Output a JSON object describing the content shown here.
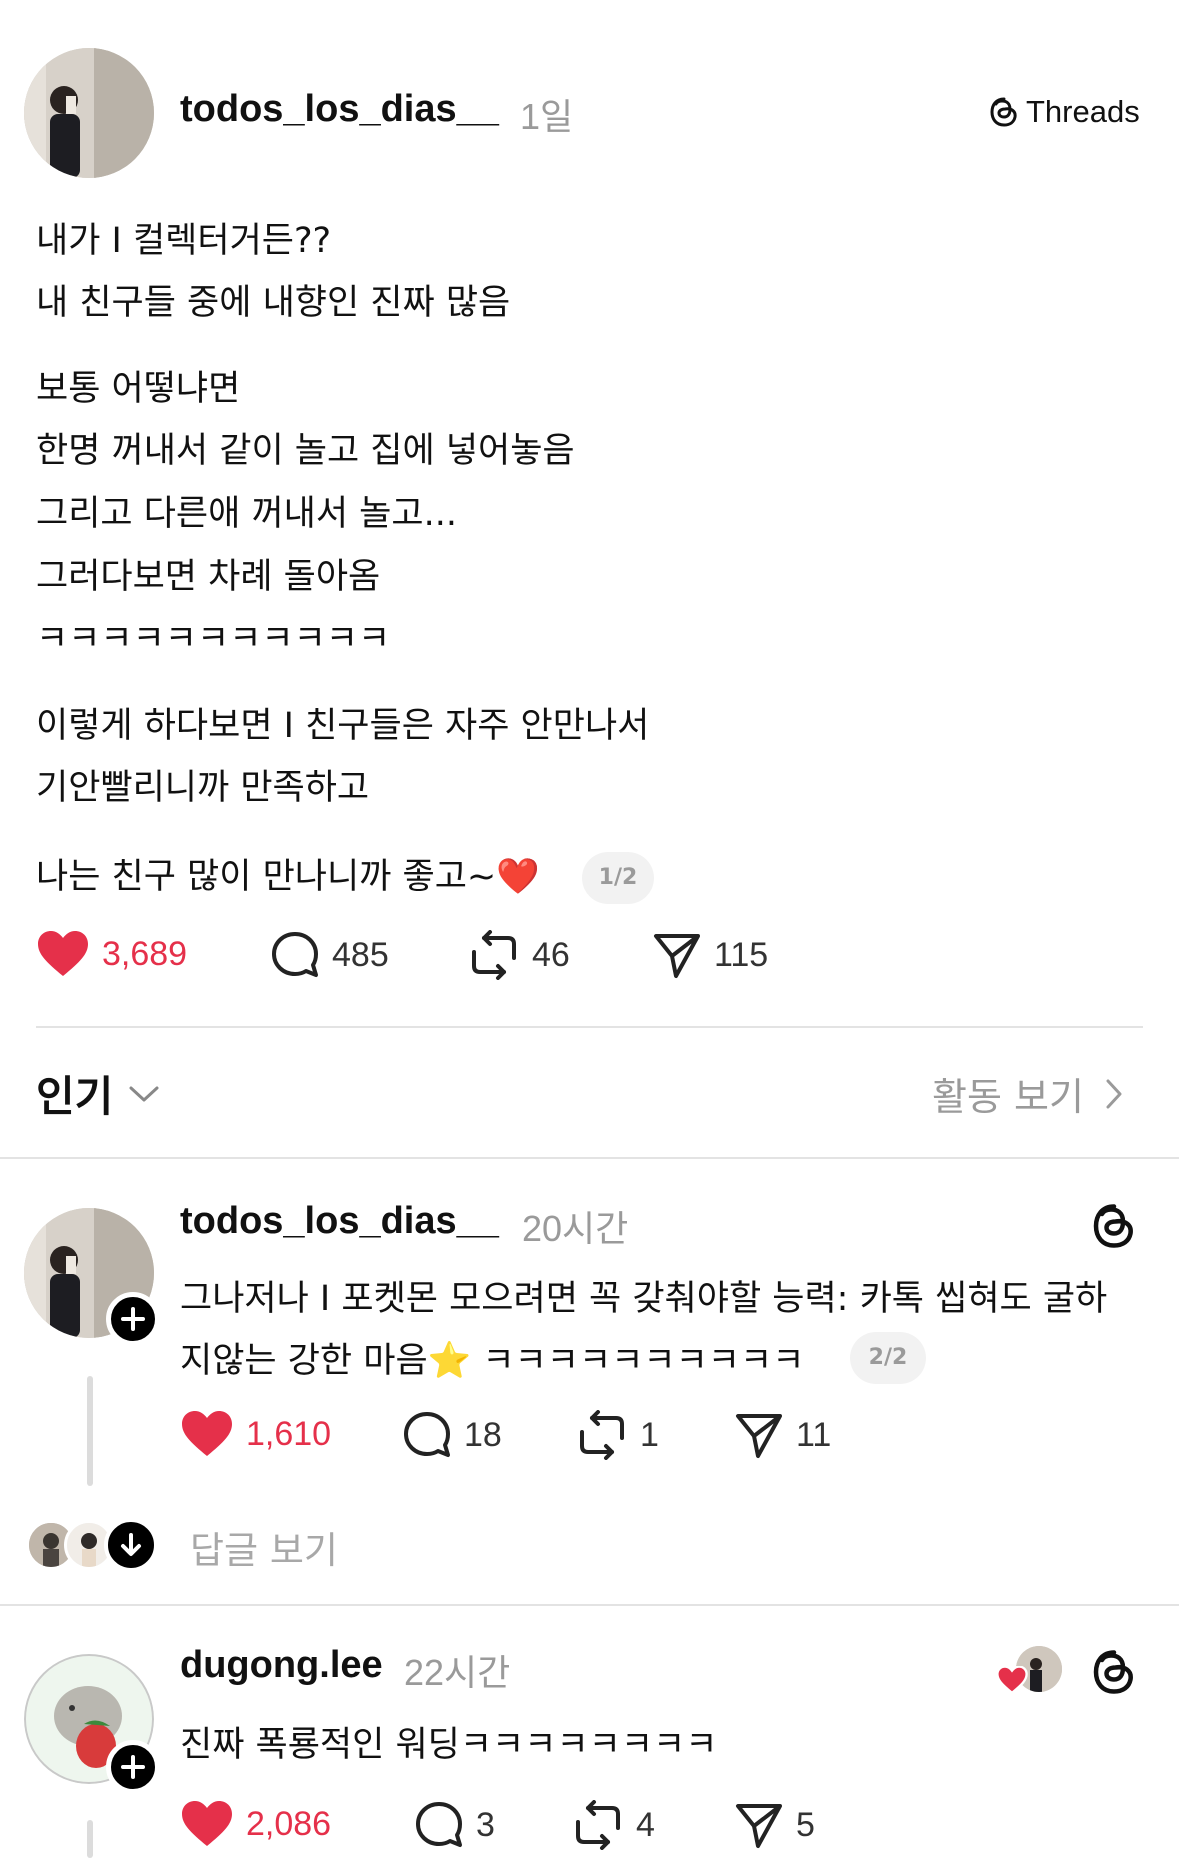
{
  "threads_logo_label": "Threads",
  "main_post": {
    "username": "todos_los_dias__",
    "time": "1일",
    "lines": [
      "내가 I 컬렉터거든??",
      "내 친구들 중에 내향인 진짜 많음",
      "보통 어떻냐면",
      "한명 꺼내서 같이 놀고 집에 넣어놓음",
      "그리고 다른애 꺼내서 놀고...",
      "그러다보면 차례 돌아옴",
      "ㅋㅋㅋㅋㅋㅋㅋㅋㅋㅋㅋ",
      "이렇게 하다보면 I 친구들은 자주 안만나서",
      "기안빨리니까 만족하고",
      "나는 친구 많이 만나니까 좋고~"
    ],
    "last_line_emoji": "❤️",
    "pager": "1/2",
    "likes": "3,689",
    "comments": "485",
    "reposts": "46",
    "shares": "115"
  },
  "sort_bar": {
    "label": "인기",
    "activity_link": "활동 보기"
  },
  "replies": [
    {
      "username": "todos_los_dias__",
      "time": "20시간",
      "line1": "그나저나 I 포켓몬 모으려면 꼭 갖춰야할 능력: 카톡 씹혀도 굴하",
      "line2": "지않는 강한 마음",
      "emoji": "⭐",
      "line2_tail": "ㅋㅋㅋㅋㅋㅋㅋㅋㅋㅋ",
      "pager": "2/2",
      "likes": "1,610",
      "comments": "18",
      "reposts": "1",
      "shares": "11",
      "view_replies": "답글 보기"
    },
    {
      "username": "dugong.lee",
      "time": "22시간",
      "line1": "진짜 폭룡적인 워딩ㅋㅋㅋㅋㅋㅋㅋㅋ",
      "likes": "2,086",
      "comments": "3",
      "reposts": "4",
      "shares": "5"
    }
  ],
  "colors": {
    "like_red": "#e5304a",
    "text": "#111111",
    "muted": "#9a9a9a",
    "divider": "#e3e3e3"
  }
}
